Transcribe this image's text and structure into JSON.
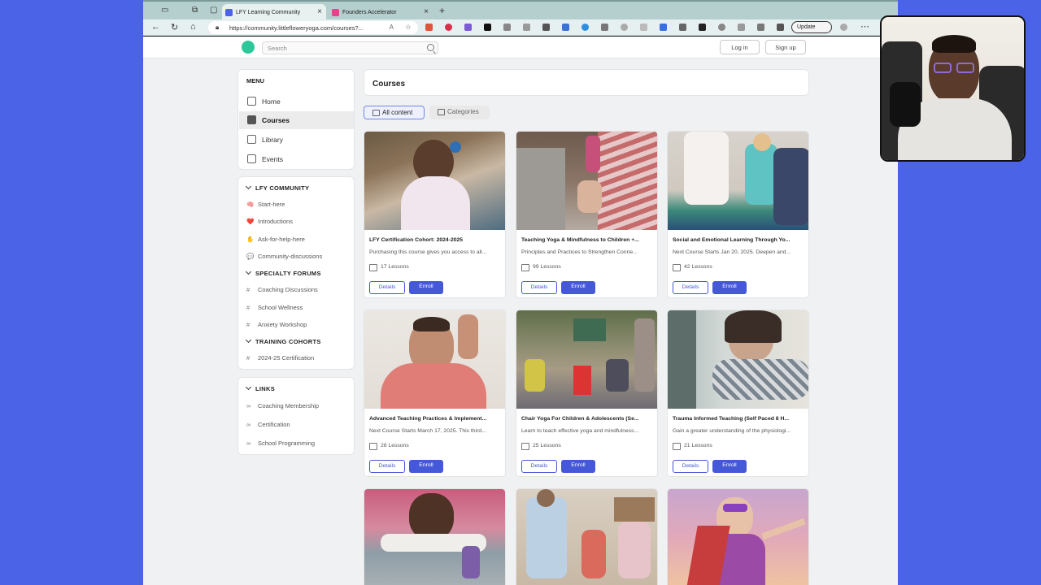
{
  "browser": {
    "tabs": [
      {
        "label": "LFY Learning Community",
        "active": true,
        "close": "×"
      },
      {
        "label": "Founders Accelerator",
        "active": false,
        "close": "×"
      }
    ],
    "new_tab": "+",
    "url": "https://community.littlefloweryoga.com/courses?...",
    "update_label": "Update",
    "more": "⋯"
  },
  "site": {
    "search_placeholder": "Search",
    "login_label": "Log in",
    "signup_label": "Sign up"
  },
  "menu": {
    "title": "MENU",
    "items": [
      {
        "label": "Home",
        "active": false
      },
      {
        "label": "Courses",
        "active": true
      },
      {
        "label": "Library",
        "active": false
      },
      {
        "label": "Events",
        "active": false
      }
    ]
  },
  "community": {
    "groups": [
      {
        "title": "LFY COMMUNITY",
        "items": [
          {
            "icon": "🧠",
            "label": "Start-here"
          },
          {
            "icon": "❤️",
            "label": "Introductions"
          },
          {
            "icon": "✋",
            "label": "Ask-for-help-here"
          },
          {
            "icon": "💬",
            "label": "Community-discussions"
          }
        ]
      },
      {
        "title": "SPECIALTY FORUMS",
        "items": [
          {
            "icon": "#",
            "label": "Coaching Discussions"
          },
          {
            "icon": "#",
            "label": "School Wellness"
          },
          {
            "icon": "#",
            "label": "Anxiety Workshop"
          }
        ]
      },
      {
        "title": "TRAINING COHORTS",
        "items": [
          {
            "icon": "#",
            "label": "2024-25 Certification"
          }
        ]
      }
    ]
  },
  "links": {
    "title": "LINKS",
    "items": [
      "Coaching Membership",
      "Certification",
      "School Programming"
    ]
  },
  "courses": {
    "title": "Courses",
    "filters": [
      "All content",
      "Categories"
    ],
    "details_label": "Details",
    "enroll_label": "Enroll",
    "list": [
      {
        "title": "LFY Certification Cohort: 2024-2025",
        "desc": "Purchasing this course gives you access to all...",
        "lessons": "17 Lessons"
      },
      {
        "title": "Teaching Yoga & Mindfulness to Children +...",
        "desc": "Principles and Practices to Strengthen Conne...",
        "lessons": "99 Lessons"
      },
      {
        "title": "Social and Emotional Learning Through Yo...",
        "desc": "Next Course Starts Jan 20, 2025. Deepen and...",
        "lessons": "42 Lessons"
      },
      {
        "title": "Advanced Teaching Practices & Implement...",
        "desc": "Next Course Starts March 17, 2025. This third...",
        "lessons": "28 Lessons"
      },
      {
        "title": "Chair Yoga For Children & Adolescents (Se...",
        "desc": "Learn to teach effective yoga and mindfulness...",
        "lessons": "25 Lessons"
      },
      {
        "title": "Trauma Informed Teaching (Self Paced 8 H...",
        "desc": "Gain a greater understanding of the physiologi...",
        "lessons": "21 Lessons"
      }
    ]
  },
  "colors": {
    "accent": "#4558d8",
    "frame_background": "#4a63e7",
    "logo": "#2cc89a"
  }
}
